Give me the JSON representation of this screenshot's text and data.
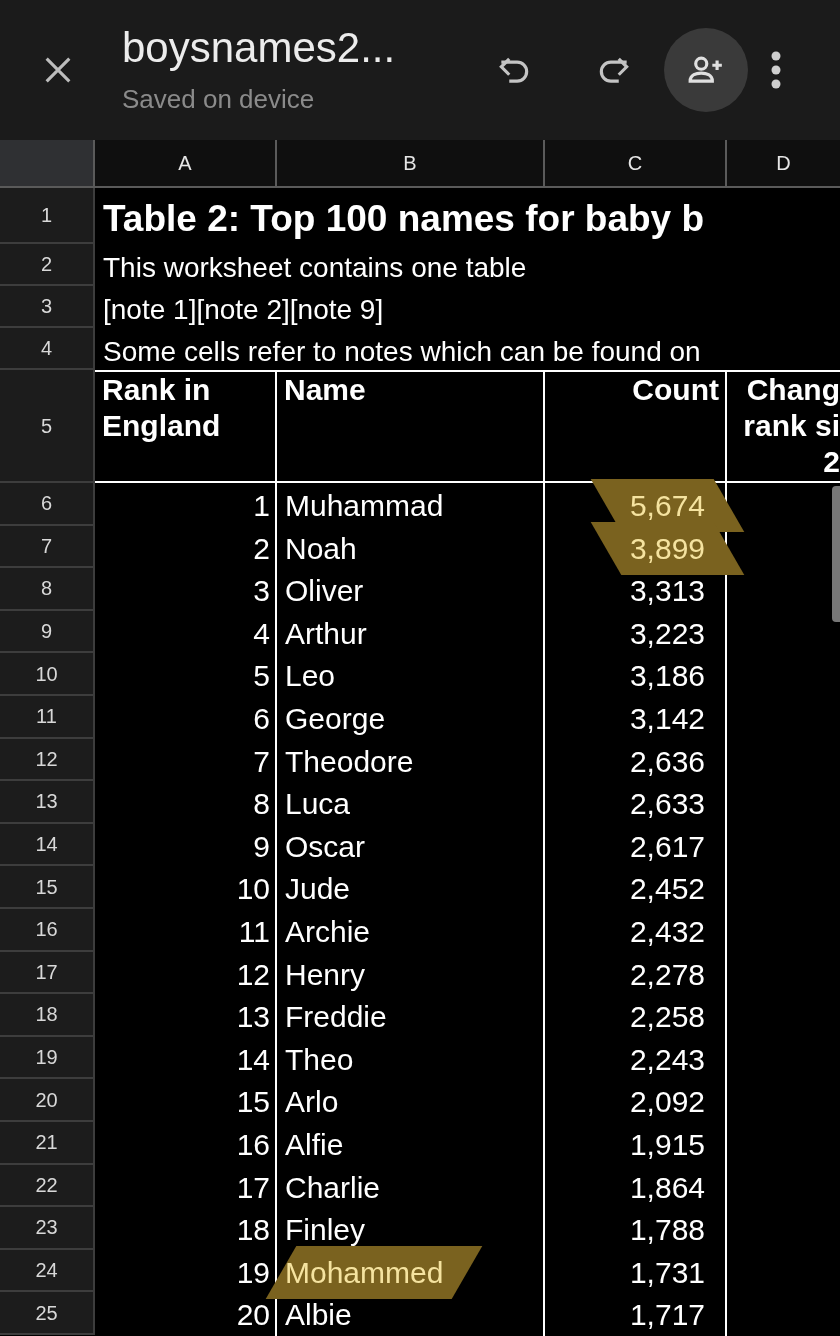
{
  "top_bar": {
    "title": "boysnames2...",
    "subtitle": "Saved on device"
  },
  "column_headers": [
    "A",
    "B",
    "C",
    "D"
  ],
  "intro_rows": [
    {
      "row": "1",
      "text": "Table 2: Top 100 names for baby b",
      "kind": "title"
    },
    {
      "row": "2",
      "text": "This worksheet contains one table",
      "kind": "text"
    },
    {
      "row": "3",
      "text": "[note 1][note 2][note 9]",
      "kind": "text"
    },
    {
      "row": "4",
      "text": "Some cells refer to notes which can be found on",
      "kind": "text"
    }
  ],
  "header_row": {
    "row": "5",
    "rank": [
      "Rank in",
      "England"
    ],
    "name": "Name",
    "count": "Count",
    "column_4": [
      "Chang",
      "rank si",
      "2"
    ]
  },
  "rows": [
    {
      "row": "6",
      "rank": "1",
      "name": "Muhammad",
      "count": "5,674",
      "name_highlighted": false,
      "count_highlighted": true
    },
    {
      "row": "7",
      "rank": "2",
      "name": "Noah",
      "count": "3,899",
      "name_highlighted": false,
      "count_highlighted": true
    },
    {
      "row": "8",
      "rank": "3",
      "name": "Oliver",
      "count": "3,313",
      "name_highlighted": false,
      "count_highlighted": false
    },
    {
      "row": "9",
      "rank": "4",
      "name": "Arthur",
      "count": "3,223",
      "name_highlighted": false,
      "count_highlighted": false
    },
    {
      "row": "10",
      "rank": "5",
      "name": "Leo",
      "count": "3,186",
      "name_highlighted": false,
      "count_highlighted": false
    },
    {
      "row": "11",
      "rank": "6",
      "name": "George",
      "count": "3,142",
      "name_highlighted": false,
      "count_highlighted": false
    },
    {
      "row": "12",
      "rank": "7",
      "name": "Theodore",
      "count": "2,636",
      "name_highlighted": false,
      "count_highlighted": false
    },
    {
      "row": "13",
      "rank": "8",
      "name": "Luca",
      "count": "2,633",
      "name_highlighted": false,
      "count_highlighted": false
    },
    {
      "row": "14",
      "rank": "9",
      "name": "Oscar",
      "count": "2,617",
      "name_highlighted": false,
      "count_highlighted": false
    },
    {
      "row": "15",
      "rank": "10",
      "name": "Jude",
      "count": "2,452",
      "name_highlighted": false,
      "count_highlighted": false
    },
    {
      "row": "16",
      "rank": "11",
      "name": "Archie",
      "count": "2,432",
      "name_highlighted": false,
      "count_highlighted": false
    },
    {
      "row": "17",
      "rank": "12",
      "name": "Henry",
      "count": "2,278",
      "name_highlighted": false,
      "count_highlighted": false
    },
    {
      "row": "18",
      "rank": "13",
      "name": "Freddie",
      "count": "2,258",
      "name_highlighted": false,
      "count_highlighted": false
    },
    {
      "row": "19",
      "rank": "14",
      "name": "Theo",
      "count": "2,243",
      "name_highlighted": false,
      "count_highlighted": false
    },
    {
      "row": "20",
      "rank": "15",
      "name": "Arlo",
      "count": "2,092",
      "name_highlighted": false,
      "count_highlighted": false
    },
    {
      "row": "21",
      "rank": "16",
      "name": "Alfie",
      "count": "1,915",
      "name_highlighted": false,
      "count_highlighted": false
    },
    {
      "row": "22",
      "rank": "17",
      "name": "Charlie",
      "count": "1,864",
      "name_highlighted": false,
      "count_highlighted": false
    },
    {
      "row": "23",
      "rank": "18",
      "name": "Finley",
      "count": "1,788",
      "name_highlighted": false,
      "count_highlighted": false
    },
    {
      "row": "24",
      "rank": "19",
      "name": "Mohammed",
      "count": "1,731",
      "name_highlighted": true,
      "count_highlighted": false
    },
    {
      "row": "25",
      "rank": "20",
      "name": "Albie",
      "count": "1,717",
      "name_highlighted": false,
      "count_highlighted": false
    }
  ]
}
